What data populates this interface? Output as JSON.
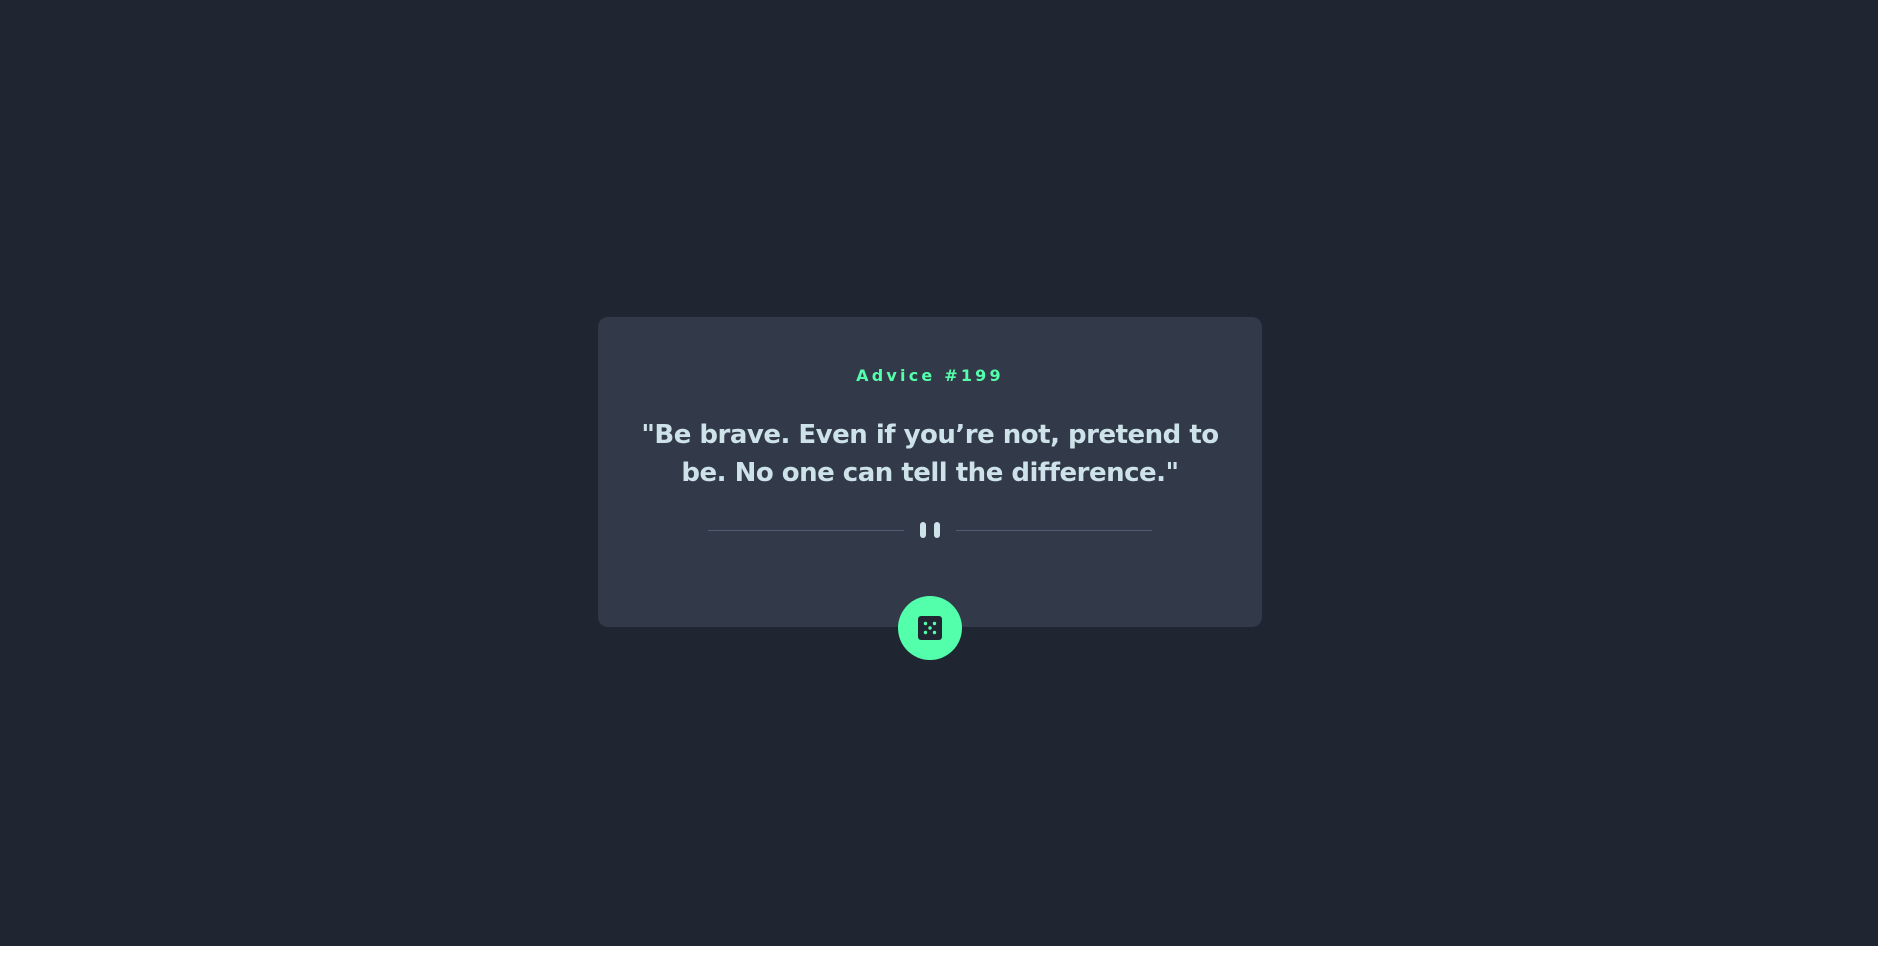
{
  "advice": {
    "label": "Advice #199",
    "quote": "\"Be brave. Even if you’re not, pretend to be. No one can tell the difference.\""
  },
  "button": {
    "icon": "dice-icon",
    "action_color": "#53ffaa"
  },
  "colors": {
    "background": "#1f2631",
    "card": "#323a49",
    "accent": "#53ffaa",
    "text": "#cee3e9",
    "divider": "#4f5d74"
  }
}
